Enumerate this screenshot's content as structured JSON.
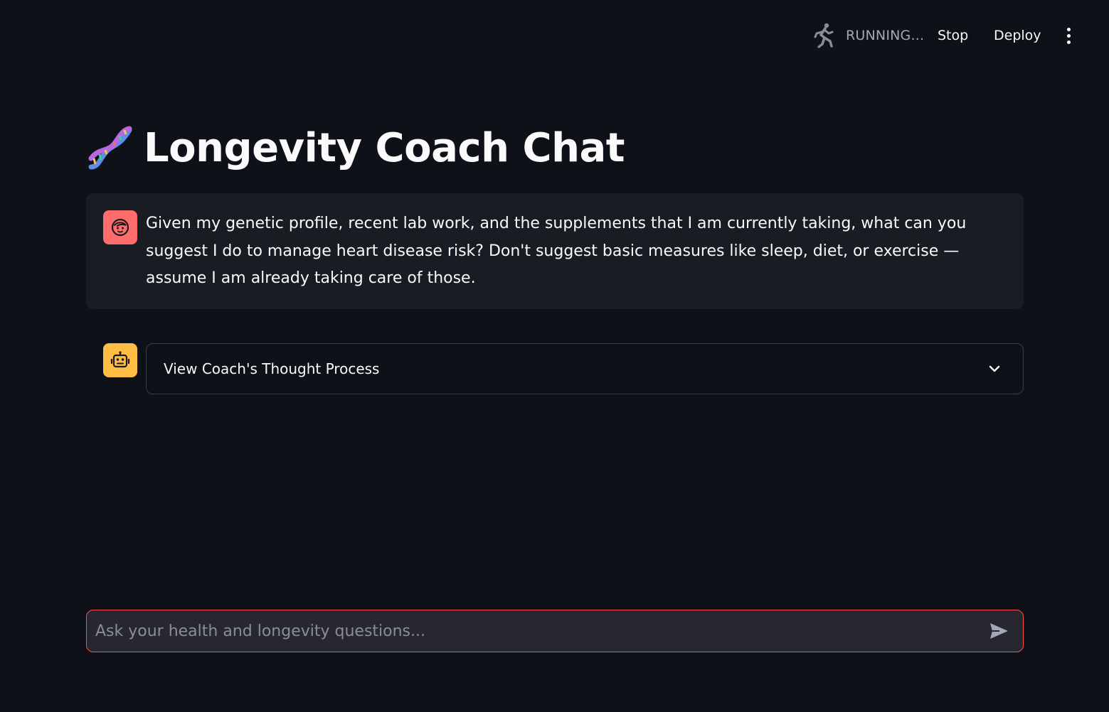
{
  "header": {
    "status_text": "RUNNING...",
    "stop_label": "Stop",
    "deploy_label": "Deploy",
    "menu_icon": "kebab-menu-icon",
    "status_icon": "running-man-icon"
  },
  "page": {
    "title": "Longevity Coach Chat",
    "title_icon": "dna-icon"
  },
  "messages": [
    {
      "role": "user",
      "avatar_icon": "face-icon",
      "avatar_color": "#ff6c6c",
      "text": "Given my genetic profile, recent lab work, and the supplements that I am currently taking, what can you suggest I do to manage heart disease risk? Don't suggest basic measures like sleep, diet, or exercise — assume I am already taking care of those."
    },
    {
      "role": "assistant",
      "avatar_icon": "robot-icon",
      "avatar_color": "#ffbd45",
      "expander_label": "View Coach's Thought Process",
      "expander_icon": "chevron-down-icon"
    }
  ],
  "chat_input": {
    "placeholder": "Ask your health and longevity questions...",
    "value": "",
    "send_icon": "send-icon"
  },
  "colors": {
    "background": "#0e1117",
    "user_bubble": "#1a1c24",
    "input_border": "#ff4b4b",
    "input_bg": "#262730"
  }
}
